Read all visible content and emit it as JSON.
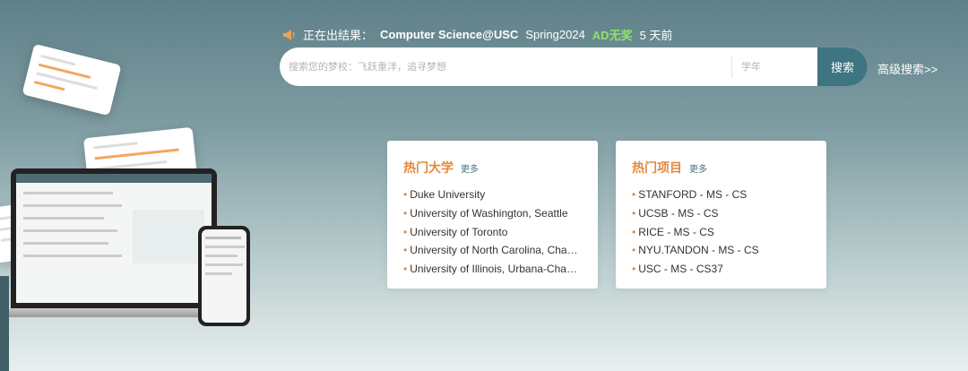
{
  "announcement": {
    "icon": "megaphone-icon",
    "label": "正在出结果：",
    "program": "Computer Science@USC",
    "term": "Spring2024",
    "result": "AD无奖",
    "time": "5 天前"
  },
  "search": {
    "placeholder": "搜索您的梦校：飞跃重洋，追寻梦想",
    "year_placeholder": "学年",
    "button": "搜索",
    "advanced": "高级搜索>>"
  },
  "hot_universities": {
    "title": "热门大学",
    "more": "更多",
    "items": [
      "Duke University",
      "University of Washington, Seattle",
      "University of Toronto",
      "University of North Carolina, Chapel Hill",
      "University of Illinois, Urbana-Champaign"
    ]
  },
  "hot_programs": {
    "title": "热门项目",
    "more": "更多",
    "items": [
      "STANFORD - MS - CS",
      "UCSB - MS - CS",
      "RICE - MS - CS",
      "NYU.TANDON - MS - CS",
      "USC - MS - CS37"
    ]
  },
  "colors": {
    "accent_orange": "#e18a3c",
    "result_green": "#8ee36a",
    "button_teal": "#3f7482"
  }
}
